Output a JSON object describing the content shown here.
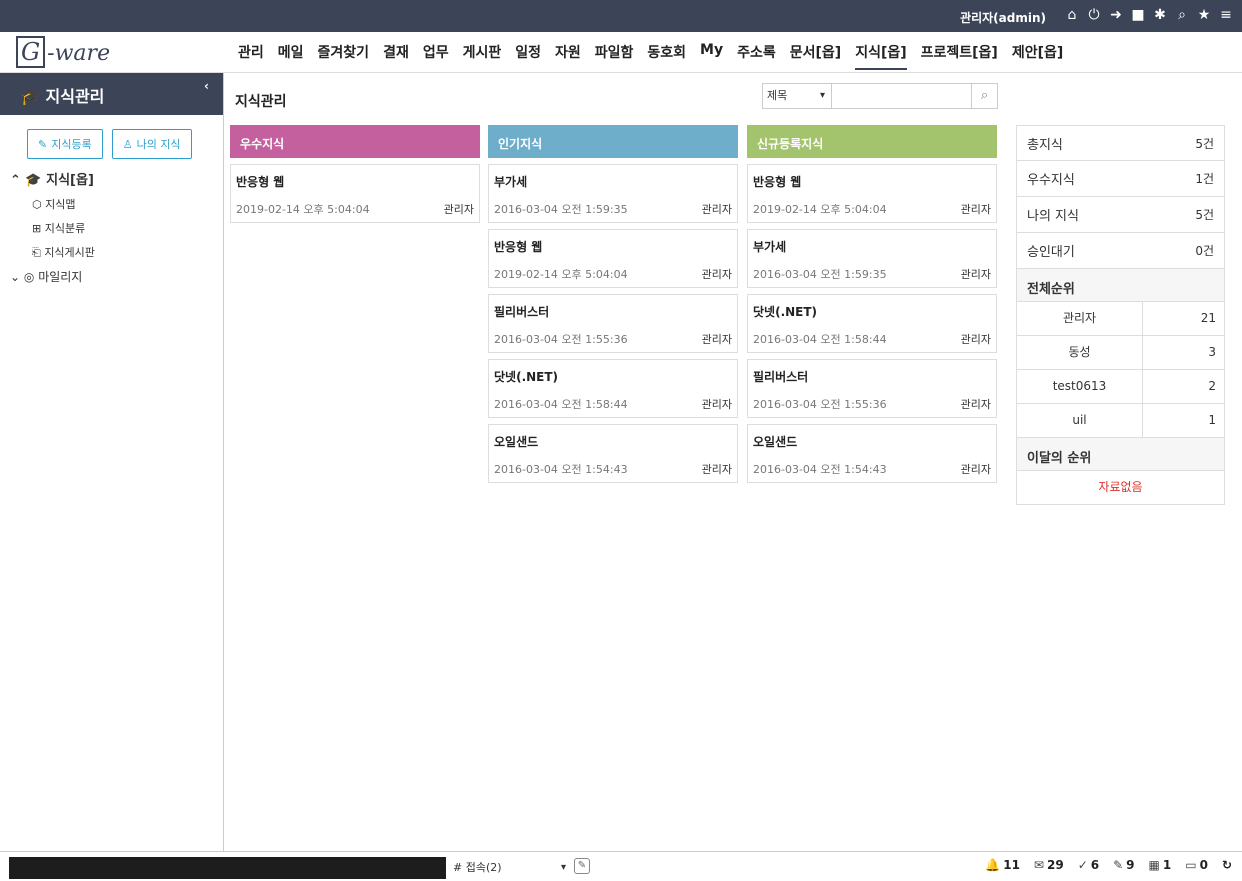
{
  "topbar": {
    "user": "관리자(admin)",
    "icons": [
      "home-icon",
      "power-icon",
      "logout-icon",
      "note-icon",
      "settings-icon",
      "search-icon",
      "star-icon",
      "menu-icon"
    ]
  },
  "logo": {
    "g": "G",
    "rest": "-ware"
  },
  "menu": [
    {
      "label": "관리"
    },
    {
      "label": "메일"
    },
    {
      "label": "즐겨찾기"
    },
    {
      "label": "결재"
    },
    {
      "label": "업무"
    },
    {
      "label": "게시판"
    },
    {
      "label": "일정"
    },
    {
      "label": "자원"
    },
    {
      "label": "파일함"
    },
    {
      "label": "동호회"
    },
    {
      "label": "My"
    },
    {
      "label": "주소록"
    },
    {
      "label": "문서[옵]"
    },
    {
      "label": "지식[옵]",
      "active": true
    },
    {
      "label": "프로젝트[옵]"
    },
    {
      "label": "제안[옵]"
    }
  ],
  "sidebar": {
    "title": "지식관리",
    "buttons": {
      "register": "지식등록",
      "mine": "나의 지식"
    },
    "tree": {
      "root": "지식[옵]",
      "children": [
        "지식맵",
        "지식분류",
        "지식게시판"
      ],
      "mileage": "마일리지"
    }
  },
  "main": {
    "title": "지식관리",
    "search": {
      "field": "제목",
      "placeholder": ""
    }
  },
  "columns": [
    {
      "title": "우수지식",
      "color": "#c5609f",
      "items": [
        {
          "title": "반응형 웹",
          "date": "2019-02-14 오후 5:04:04",
          "author": "관리자"
        }
      ]
    },
    {
      "title": "인기지식",
      "color": "#6faecb",
      "items": [
        {
          "title": "부가세",
          "date": "2016-03-04 오전 1:59:35",
          "author": "관리자"
        },
        {
          "title": "반응형 웹",
          "date": "2019-02-14 오후 5:04:04",
          "author": "관리자"
        },
        {
          "title": "필리버스터",
          "date": "2016-03-04 오전 1:55:36",
          "author": "관리자"
        },
        {
          "title": "닷넷(.NET)",
          "date": "2016-03-04 오전 1:58:44",
          "author": "관리자"
        },
        {
          "title": "오일샌드",
          "date": "2016-03-04 오전 1:54:43",
          "author": "관리자"
        }
      ]
    },
    {
      "title": "신규등록지식",
      "color": "#a3c36d",
      "items": [
        {
          "title": "반응형 웹",
          "date": "2019-02-14 오후 5:04:04",
          "author": "관리자"
        },
        {
          "title": "부가세",
          "date": "2016-03-04 오전 1:59:35",
          "author": "관리자"
        },
        {
          "title": "닷넷(.NET)",
          "date": "2016-03-04 오전 1:58:44",
          "author": "관리자"
        },
        {
          "title": "필리버스터",
          "date": "2016-03-04 오전 1:55:36",
          "author": "관리자"
        },
        {
          "title": "오일샌드",
          "date": "2016-03-04 오전 1:54:43",
          "author": "관리자"
        }
      ]
    }
  ],
  "stats": {
    "rows": [
      {
        "label": "총지식",
        "value": "5건"
      },
      {
        "label": "우수지식",
        "value": "1건"
      },
      {
        "label": "나의 지식",
        "value": "5건"
      },
      {
        "label": "승인대기",
        "value": "0건"
      }
    ],
    "overall_title": "전체순위",
    "overall": [
      {
        "name": "관리자",
        "count": "21"
      },
      {
        "name": "동성",
        "count": "3"
      },
      {
        "name": "test0613",
        "count": "2"
      },
      {
        "name": "uil",
        "count": "1"
      }
    ],
    "monthly_title": "이달의 순위",
    "monthly_empty": "자료없음"
  },
  "footer": {
    "select": "# 접속(2)",
    "badges": [
      {
        "icon": "bell-icon",
        "glyph": "🔔",
        "count": "11"
      },
      {
        "icon": "mail-icon",
        "glyph": "✉",
        "count": "29"
      },
      {
        "icon": "approval-icon",
        "glyph": "✓",
        "count": "6"
      },
      {
        "icon": "pen-icon",
        "glyph": "✎",
        "count": "9"
      },
      {
        "icon": "calendar-icon",
        "glyph": "▦",
        "count": "1"
      },
      {
        "icon": "chat-icon",
        "glyph": "▭",
        "count": "0"
      }
    ]
  }
}
